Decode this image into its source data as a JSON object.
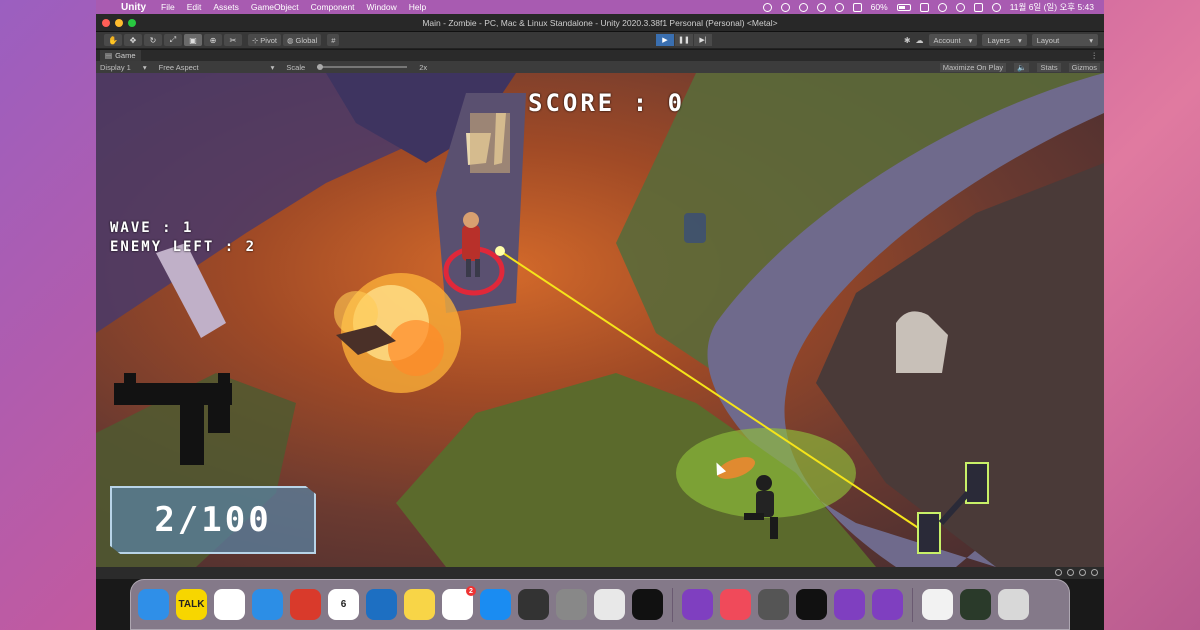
{
  "menubar": {
    "app": "Unity",
    "items": [
      "File",
      "Edit",
      "Assets",
      "GameObject",
      "Component",
      "Window",
      "Help"
    ],
    "battery": "60%",
    "battery_level": 0.6,
    "clock": "11월 6일 (일) 오후 5:43"
  },
  "window": {
    "title": "Main - Zombie - PC, Mac & Linux Standalone - Unity 2020.3.38f1 Personal (Personal) <Metal>"
  },
  "toolbar": {
    "pivot": "Pivot",
    "global": "Global",
    "account": "Account",
    "layers": "Layers",
    "layout": "Layout"
  },
  "game_view": {
    "tab": "Game",
    "display": "Display 1",
    "aspect": "Free Aspect",
    "scale_label": "Scale",
    "scale_value": "2x",
    "maximize": "Maximize On Play",
    "stats": "Stats",
    "gizmos": "Gizmos"
  },
  "hud": {
    "score": "SCORE : 0",
    "wave": "WAVE : 1",
    "enemy_left": "ENEMY LEFT : 2",
    "ammo": "2/100"
  },
  "dock": {
    "apps": [
      {
        "name": "finder",
        "color": "#2f8fe8",
        "label": ""
      },
      {
        "name": "kakaotalk",
        "color": "#f7d600",
        "label": "TALK"
      },
      {
        "name": "chrome",
        "color": "#ffffff",
        "label": ""
      },
      {
        "name": "safari",
        "color": "#2c8ee6",
        "label": ""
      },
      {
        "name": "remote-desktop",
        "color": "#d93a2b",
        "label": ""
      },
      {
        "name": "calendar",
        "color": "#ffffff",
        "label": "6"
      },
      {
        "name": "vscode",
        "color": "#1d6fc2",
        "label": ""
      },
      {
        "name": "notes",
        "color": "#f8d547",
        "label": ""
      },
      {
        "name": "reminders",
        "color": "#ffffff",
        "label": ""
      },
      {
        "name": "app-store",
        "color": "#1a8cf2",
        "label": ""
      },
      {
        "name": "calculator",
        "color": "#333333",
        "label": ""
      },
      {
        "name": "system-preferences",
        "color": "#888888",
        "label": ""
      },
      {
        "name": "launchpad",
        "color": "#e8e8e8",
        "label": ""
      },
      {
        "name": "terminal",
        "color": "#111111",
        "label": ""
      },
      {
        "name": "visual-studio",
        "color": "#7f3fc0",
        "label": ""
      },
      {
        "name": "music",
        "color": "#f04a5a",
        "label": ""
      },
      {
        "name": "unity-hub",
        "color": "#555555",
        "label": ""
      },
      {
        "name": "unity",
        "color": "#111111",
        "label": ""
      },
      {
        "name": "visual-studio-2",
        "color": "#7f3fc0",
        "label": ""
      },
      {
        "name": "visual-studio-3",
        "color": "#7f3fc0",
        "label": ""
      },
      {
        "name": "unity-doc",
        "color": "#f2f2f2",
        "label": ""
      },
      {
        "name": "screenshot",
        "color": "#2a3a2a",
        "label": ""
      },
      {
        "name": "trash",
        "color": "#d8d8d8",
        "label": ""
      }
    ],
    "reminders_badge": "2"
  },
  "colors": {
    "menubar": "#a85bb1",
    "laser": "#f5e41a",
    "fire": "#ffb43a"
  }
}
